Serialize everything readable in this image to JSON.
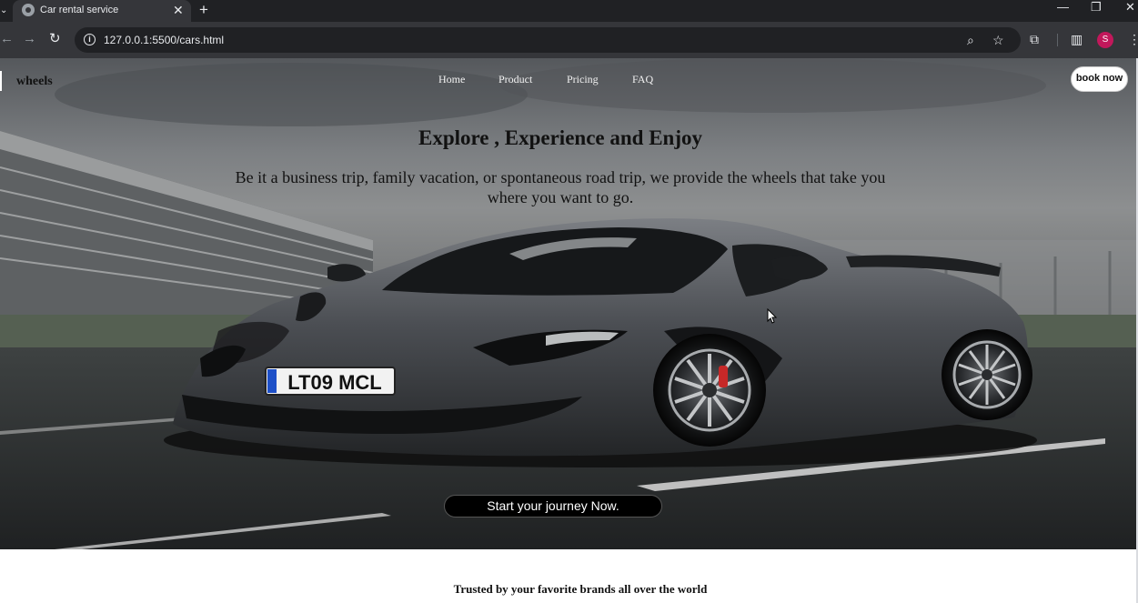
{
  "browser": {
    "tab_title": "Car rental service",
    "tab_close": "✕",
    "new_tab": "+",
    "url": "127.0.0.1:5500/cars.html",
    "profile_initial": "S",
    "profile_color": "#c2185b",
    "icons": {
      "tab_search": "chevron-down-icon",
      "back": "back-arrow-icon",
      "forward": "forward-arrow-icon",
      "reload": "reload-icon",
      "site_info": "info-icon",
      "zoom": "zoom-icon",
      "bookmark": "star-icon",
      "extensions": "puzzle-icon",
      "side_panel": "side-panel-icon",
      "menu": "kebab-menu-icon",
      "minimize": "minimize-icon",
      "maximize": "restore-icon",
      "close_window": "close-icon"
    }
  },
  "page": {
    "brand": "wheels",
    "nav": [
      "Home",
      "Product",
      "Pricing",
      "FAQ"
    ],
    "book_button": "book now",
    "hero_title": "Explore , Experience and Enjoy",
    "hero_subtitle": "Be it a business trip, family vacation, or spontaneous road trip, we provide the wheels that take you where you want to go.",
    "license_plate": "LT09 MCL",
    "cta_button": "Start your journey Now.",
    "trusted_heading": "Trusted by your favorite brands all over the world"
  },
  "colors": {
    "chrome_dark": "#202124",
    "chrome_toolbar": "#35363a",
    "cta_background": "#000000",
    "car_body": "#4a4c50",
    "brake_caliper": "#c62828"
  }
}
